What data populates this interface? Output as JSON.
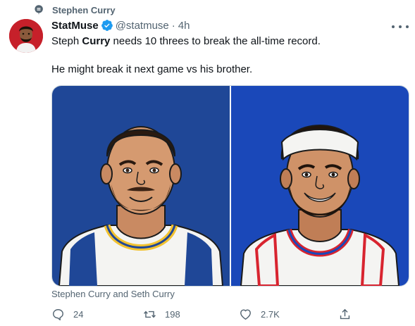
{
  "context": {
    "label": "Stephen Curry",
    "icon": "topic-icon"
  },
  "author": {
    "display_name": "StatMuse",
    "handle": "@statmuse",
    "separator": "·",
    "time": "4h",
    "verified": true,
    "avatar_icon": "avatar"
  },
  "tweet": {
    "line1_pre": "Steph ",
    "line1_bold": "Curry",
    "line1_post": " needs 10 threes to break the all-time record.",
    "line2": "He might break it next game vs his brother."
  },
  "media": {
    "left_bg": "#1f4797",
    "right_bg": "#1a48b9",
    "caption": "Stephen Curry and Seth Curry"
  },
  "actions": {
    "replies": "24",
    "retweets": "198",
    "likes": "2.7K"
  },
  "colors": {
    "text": "#0f1419",
    "muted": "#536471",
    "verified": "#1d9bf0"
  }
}
